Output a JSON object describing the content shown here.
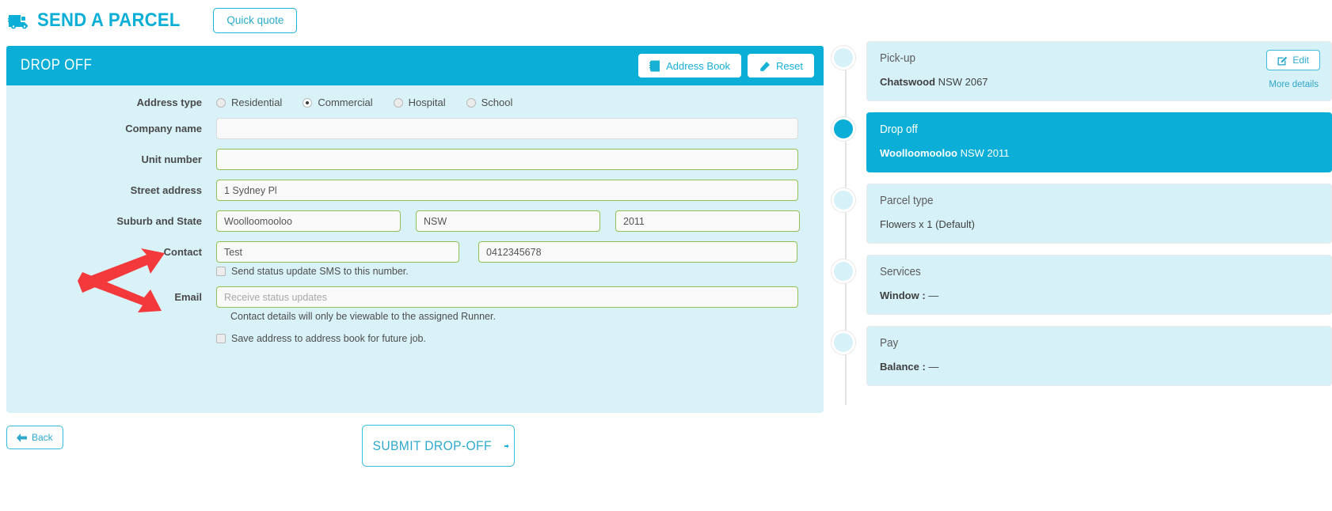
{
  "brand": {
    "title": "SEND A PARCEL",
    "truck_icon": "truck-icon",
    "quick_quote_label": "Quick quote"
  },
  "form": {
    "header_title": "DROP OFF",
    "address_book_label": "Address Book",
    "address_book_icon": "book-icon",
    "reset_label": "Reset",
    "reset_icon": "eraser-icon",
    "address_type": {
      "label": "Address type",
      "options": [
        {
          "label": "Residential",
          "checked": false
        },
        {
          "label": "Commercial",
          "checked": true
        },
        {
          "label": "Hospital",
          "checked": false
        },
        {
          "label": "School",
          "checked": false
        }
      ]
    },
    "company_name": {
      "label": "Company name",
      "value": "",
      "placeholder": ""
    },
    "unit_number": {
      "label": "Unit number",
      "value": "",
      "placeholder": ""
    },
    "street_address": {
      "label": "Street address",
      "value": "1 Sydney Pl",
      "placeholder": ""
    },
    "suburb_and_state": {
      "label": "Suburb and State",
      "suburb": "Woolloomooloo",
      "state": "NSW",
      "postcode": "2011"
    },
    "contact": {
      "label": "Contact",
      "name": "Test",
      "phone": "0412345678",
      "sms_checkbox_label": "Send status update SMS to this number.",
      "sms_checked": false
    },
    "email": {
      "label": "Email",
      "value": "",
      "placeholder": "Receive status updates"
    },
    "privacy_note": "Contact details will only be viewable to the assigned Runner.",
    "save_address": {
      "label": "Save address to address book for future job.",
      "checked": false
    }
  },
  "actions": {
    "back_label": "Back",
    "back_icon": "arrow-left-icon",
    "submit_label": "SUBMIT DROP-OFF",
    "submit_icon": "arrow-right-icon"
  },
  "sidebar": {
    "steps": [
      {
        "title": "Pick-up",
        "body": "Chatswood NSW 2067",
        "body_bold": "Chatswood",
        "body_rest": " NSW 2067",
        "active": false,
        "edit_label": "Edit",
        "edit_icon": "pencil-square-icon",
        "more_label": "More details"
      },
      {
        "title": "Drop off",
        "body": "Woolloomooloo NSW 2011",
        "body_bold": "Woolloomooloo",
        "body_rest": " NSW 2011",
        "active": true
      },
      {
        "title": "Parcel type",
        "body": "Flowers x 1 (Default)",
        "active": false
      },
      {
        "title": "Services",
        "body": "Window : —",
        "body_bold": "Window :",
        "body_rest": " —",
        "active": false
      },
      {
        "title": "Pay",
        "body": "Balance : —",
        "body_bold": "Balance :",
        "body_rest": " —",
        "active": false
      }
    ]
  },
  "colors": {
    "brand": "#0aaed6",
    "panel_bg": "#d6f1f8",
    "form_bg": "#d9f2f8",
    "highlight_field": "#f7f8c2",
    "annotation": "#f4393c"
  }
}
